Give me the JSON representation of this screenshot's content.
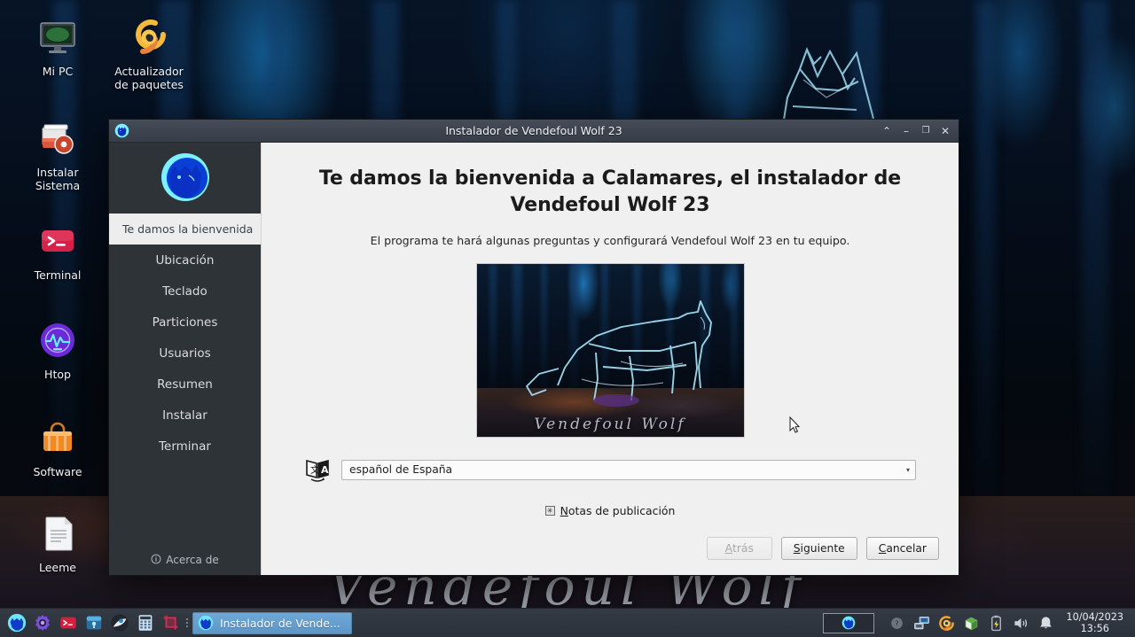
{
  "desktop": {
    "wallpaper_title": "Vendefoul Wolf",
    "icons": [
      {
        "label": "Mi PC",
        "icon": "monitor-icon"
      },
      {
        "label": "Actualizador\nde paquetes",
        "icon": "package-updater-icon"
      },
      {
        "label": "Instalar\nSistema",
        "icon": "install-system-icon"
      },
      {
        "label": "Terminal",
        "icon": "terminal-icon"
      },
      {
        "label": "Htop",
        "icon": "htop-icon"
      },
      {
        "label": "Software",
        "icon": "software-icon"
      },
      {
        "label": "Leeme",
        "icon": "readme-document-icon"
      }
    ]
  },
  "window": {
    "title": "Instalador de Vendefoul Wolf 23",
    "app_icon": "wolf-logo-icon",
    "controls": {
      "shade": "⌃",
      "minimize": "–",
      "maximize": "❐",
      "close": "✕"
    }
  },
  "sidebar": {
    "logo": "wolf-logo-icon",
    "items": [
      {
        "label": "Te damos la bienvenida",
        "active": true
      },
      {
        "label": "Ubicación",
        "active": false
      },
      {
        "label": "Teclado",
        "active": false
      },
      {
        "label": "Particiones",
        "active": false
      },
      {
        "label": "Usuarios",
        "active": false
      },
      {
        "label": "Resumen",
        "active": false
      },
      {
        "label": "Instalar",
        "active": false
      },
      {
        "label": "Terminar",
        "active": false
      }
    ],
    "about_label": "Acerca de",
    "about_icon": "info-icon"
  },
  "main": {
    "headline": "Te damos la bienvenida a Calamares, el instalador de Vendefoul Wolf 23",
    "subline": "El programa te hará algunas preguntas y configurará Vendefoul Wolf 23 en tu equipo.",
    "banner_caption": "Vendefoul Wolf",
    "language": {
      "icon": "translate-icon",
      "selected": "español de España",
      "arrow": "▾"
    },
    "release_notes": {
      "icon": "star-box-icon",
      "mnemonic": "N",
      "rest": "otas de publicación"
    }
  },
  "footer": {
    "back": {
      "mnemonic": "A",
      "rest": "trás",
      "disabled": true
    },
    "next": {
      "mnemonic": "S",
      "rest": "iguiente",
      "disabled": false
    },
    "cancel": {
      "mnemonic": "C",
      "rest": "ancelar",
      "disabled": false
    }
  },
  "taskbar": {
    "launchers": [
      {
        "name": "menu-wolf-icon"
      },
      {
        "name": "settings-gear-icon"
      },
      {
        "name": "terminal-icon"
      },
      {
        "name": "file-manager-icon"
      },
      {
        "name": "web-browser-icon"
      },
      {
        "name": "calculator-icon"
      },
      {
        "name": "screenshot-icon"
      }
    ],
    "task_button": {
      "label": "Instalador de Vende...",
      "icon": "wolf-logo-icon"
    },
    "tray": [
      {
        "name": "help-icon"
      },
      {
        "name": "network-icon"
      },
      {
        "name": "package-updater-icon"
      },
      {
        "name": "package-box-icon"
      },
      {
        "name": "battery-charging-icon"
      },
      {
        "name": "volume-icon"
      },
      {
        "name": "notification-bell-icon"
      }
    ],
    "clock": {
      "date": "10/04/2023",
      "time": "13:56"
    }
  },
  "colors": {
    "accent": "#5c97c8",
    "sidebar_bg": "#2e3338",
    "content_bg": "#f0f0f0",
    "titlebar_bg": "#3d4450",
    "wolf_cyan": "#6fe8f7"
  }
}
